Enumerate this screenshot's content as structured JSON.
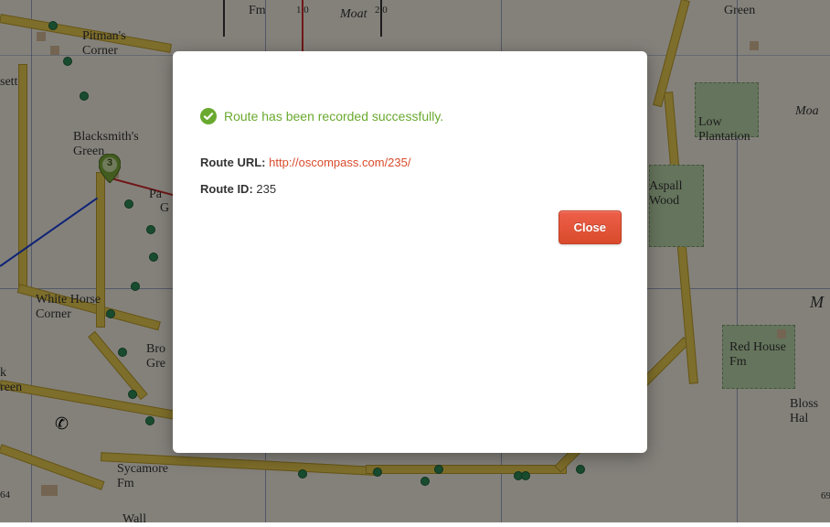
{
  "modal": {
    "success_message": "Route has been recorded successfully.",
    "route_url_label": "Route URL:",
    "route_url_value": "http://oscompass.com/235/",
    "route_id_label": "Route ID:",
    "route_id_value": "235",
    "close_label": "Close"
  },
  "map": {
    "labels": {
      "pitmans_corner": "Pitman's\nCorner",
      "blacksmith_green": "Blacksmith's\nGreen",
      "white_horse_corner": "White Horse\nCorner",
      "sycamore_fm": "Sycamore\nFm",
      "brook_green_partial": "Bro\nGre",
      "pa_partial": "Pa",
      "g_partial": "G",
      "sett_partial": "sett",
      "k_green_partial": "k\nreen",
      "fm_top": "Fm",
      "moat_partial": "Moat",
      "green_top": "Green",
      "low_plantation": "Low\nPlantation",
      "aspall_wood": "Aspall\nWood",
      "red_house_fm": "Red House\nFm",
      "bloss_hal_partial": "Bloss\nHal",
      "moa_partial": "Moa",
      "m_partial": "M",
      "num_64": "64",
      "num_69": "69",
      "scale_10": "1.0",
      "scale_20": "2.0",
      "wall_partial": "Wall"
    },
    "marker_label": "3"
  },
  "colors": {
    "success": "#6aa92f",
    "link": "#d94b2b",
    "button_bg": "#e25440"
  }
}
